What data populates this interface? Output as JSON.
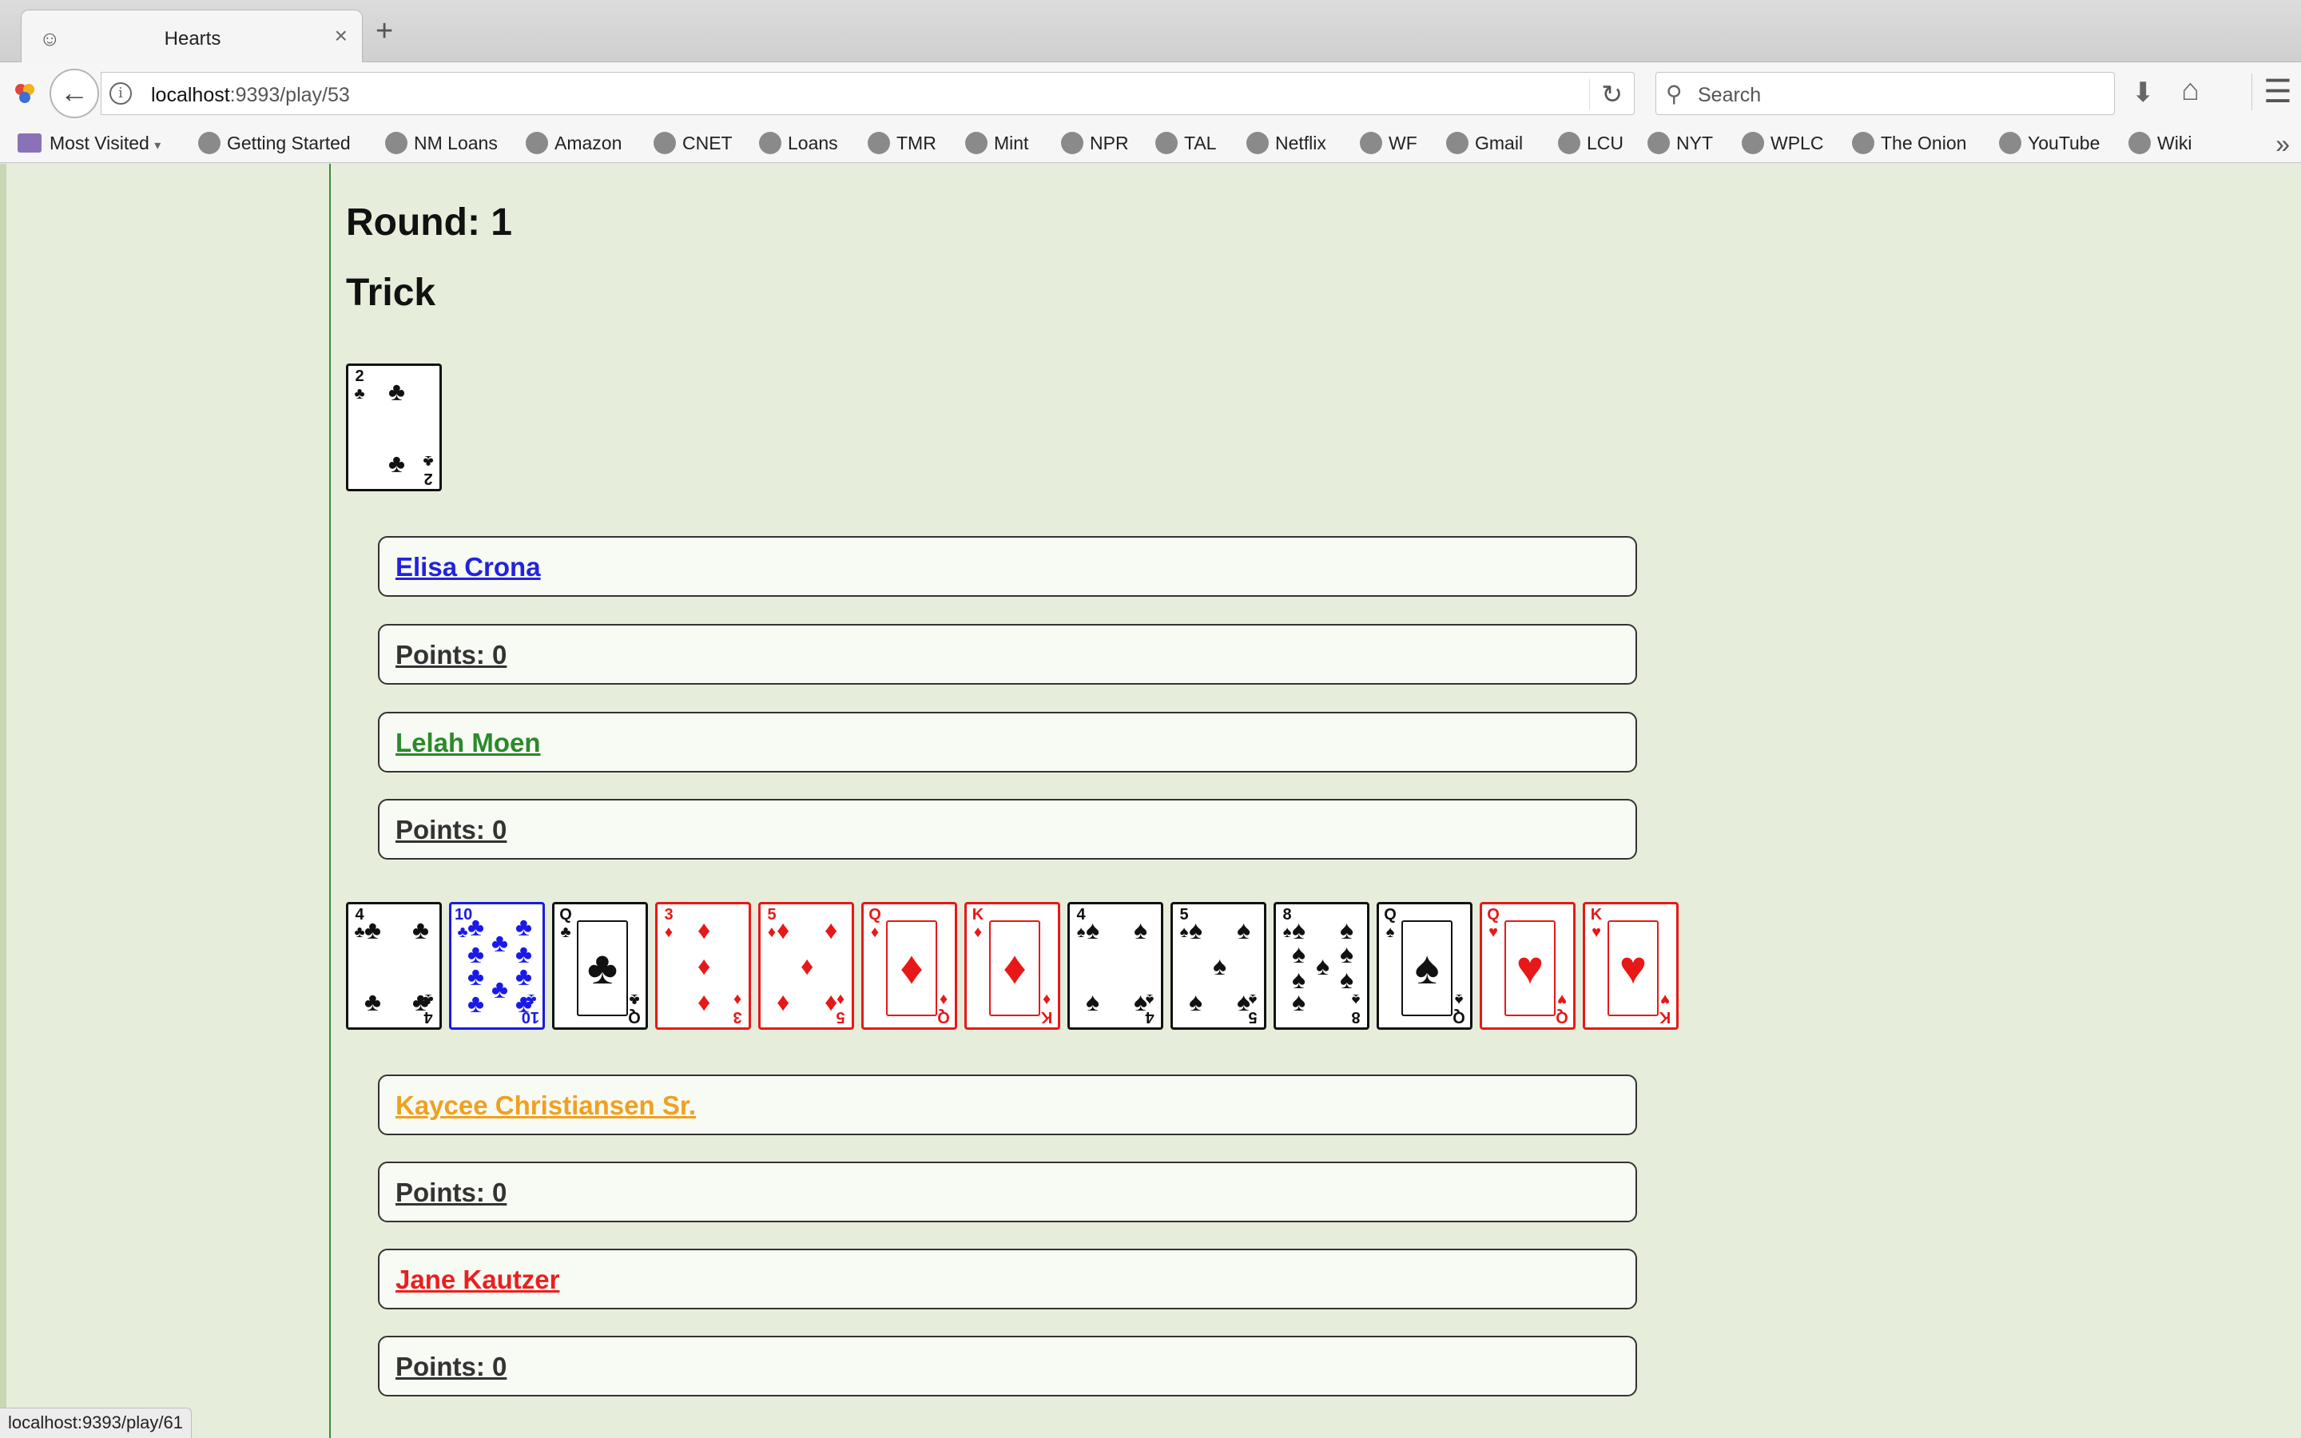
{
  "browser": {
    "tab_title": "Hearts",
    "tab_close": "×",
    "new_tab": "+",
    "url_host": "localhost",
    "url_rest": ":9393/play/53",
    "search_placeholder": "Search",
    "bookmarks": [
      "Most Visited",
      "Getting Started",
      "NM Loans",
      "Amazon",
      "CNET",
      "Loans",
      "TMR",
      "Mint",
      "NPR",
      "TAL",
      "Netflix",
      "WF",
      "Gmail",
      "LCU",
      "NYT",
      "WPLC",
      "The Onion",
      "YouTube",
      "Wiki"
    ],
    "status_url": "localhost:9393/play/61"
  },
  "game": {
    "round_label": "Round: 1",
    "trick_label": "Trick",
    "trick_cards": [
      {
        "rank": "2",
        "suit": "♣",
        "color": "black"
      }
    ],
    "players": [
      {
        "name": "Elisa Crona",
        "color": "#2222dd",
        "points": "Points: 0"
      },
      {
        "name": "Lelah Moen",
        "color": "#2a8a2a",
        "points": "Points: 0"
      },
      {
        "name": "Kaycee Christiansen Sr.",
        "color": "#f0a020",
        "points": "Points: 0"
      },
      {
        "name": "Jane Kautzer",
        "color": "#e82020",
        "points": "Points: 0"
      }
    ],
    "hand": [
      {
        "rank": "4",
        "suit": "♣",
        "color": "black"
      },
      {
        "rank": "10",
        "suit": "♣",
        "color": "blue"
      },
      {
        "rank": "Q",
        "suit": "♣",
        "color": "black"
      },
      {
        "rank": "3",
        "suit": "♦",
        "color": "red"
      },
      {
        "rank": "5",
        "suit": "♦",
        "color": "red"
      },
      {
        "rank": "Q",
        "suit": "♦",
        "color": "red"
      },
      {
        "rank": "K",
        "suit": "♦",
        "color": "red"
      },
      {
        "rank": "4",
        "suit": "♠",
        "color": "black"
      },
      {
        "rank": "5",
        "suit": "♠",
        "color": "black"
      },
      {
        "rank": "8",
        "suit": "♠",
        "color": "black"
      },
      {
        "rank": "Q",
        "suit": "♠",
        "color": "black"
      },
      {
        "rank": "Q",
        "suit": "♥",
        "color": "red"
      },
      {
        "rank": "K",
        "suit": "♥",
        "color": "red"
      }
    ]
  }
}
